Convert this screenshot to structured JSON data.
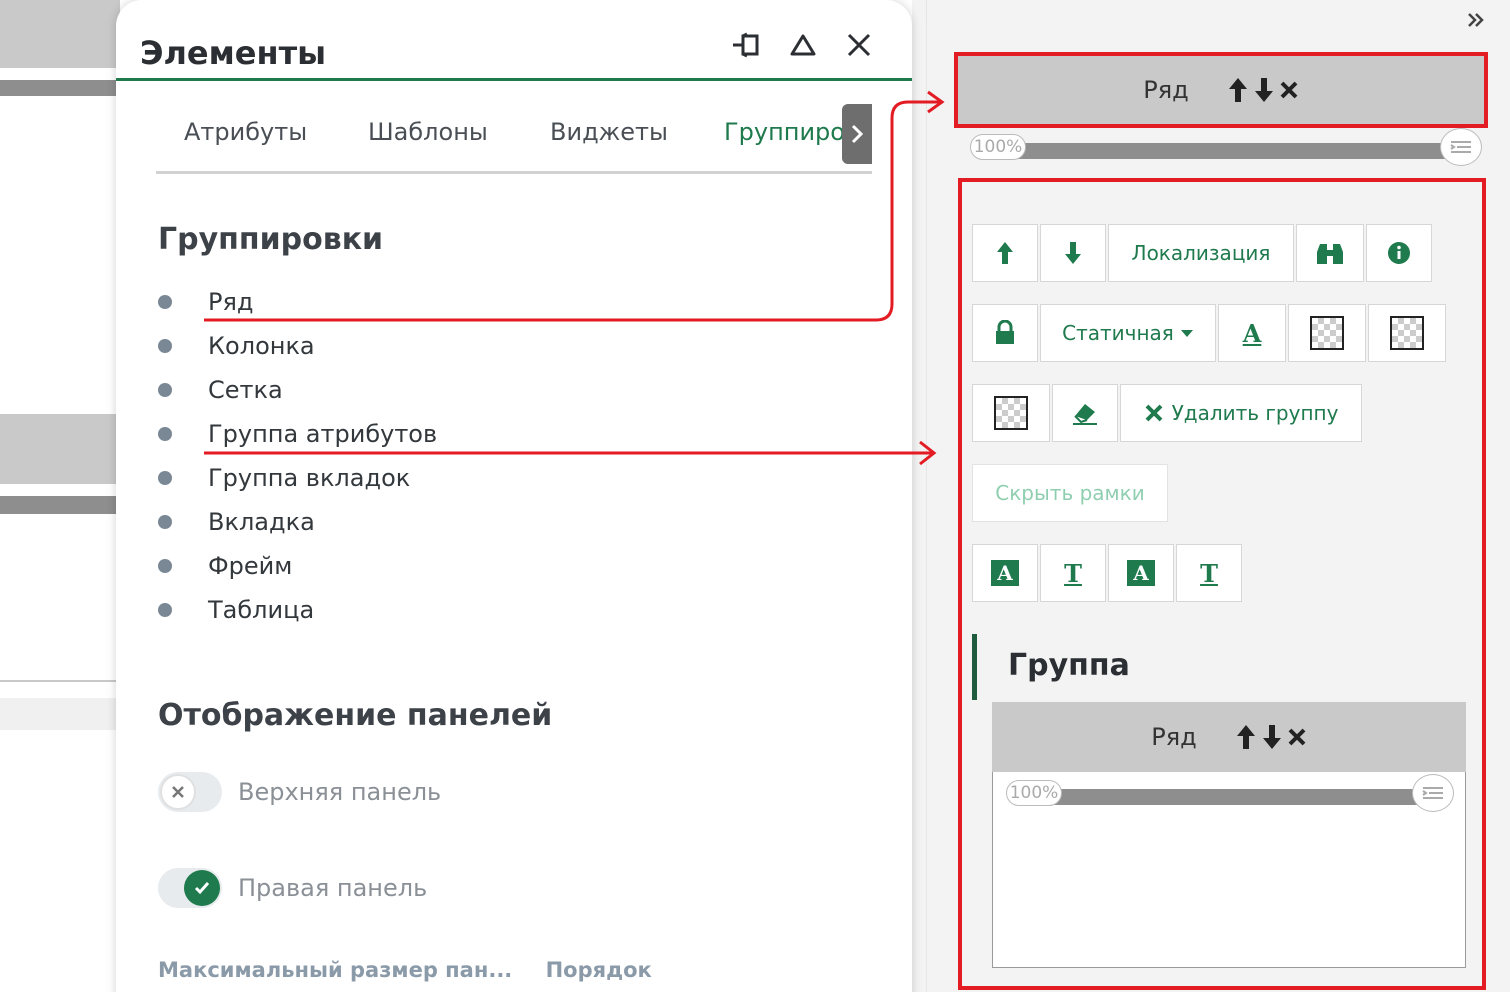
{
  "dialog": {
    "title": "Элементы",
    "tabs": [
      {
        "label": "Атрибуты"
      },
      {
        "label": "Шаблоны"
      },
      {
        "label": "Виджеты"
      },
      {
        "label": "Группиро"
      }
    ],
    "groupings_title": "Группировки",
    "groupings": [
      "Ряд",
      "Колонка",
      "Сетка",
      "Группа атрибутов",
      "Группа вкладок",
      "Вкладка",
      "Фрейм",
      "Таблица"
    ],
    "panels_title": "Отображение панелей",
    "top_panel_label": "Верхняя панель",
    "right_panel_label": "Правая панель",
    "top_panel_enabled": false,
    "right_panel_enabled": true,
    "max_size_label": "Максимальный размер пан...",
    "order_label": "Порядок"
  },
  "right_panel": {
    "row_label": "Ряд",
    "slider_value": "100%",
    "localization_label": "Локализация",
    "static_label": "Статичная",
    "delete_group_label": "Удалить группу",
    "hide_frames_label": "Скрыть рамки",
    "group_title": "Группа",
    "inner_row_label": "Ряд",
    "inner_slider_value": "100%"
  },
  "colors": {
    "accent": "#1f7a4d",
    "highlight": "#e31b23"
  }
}
